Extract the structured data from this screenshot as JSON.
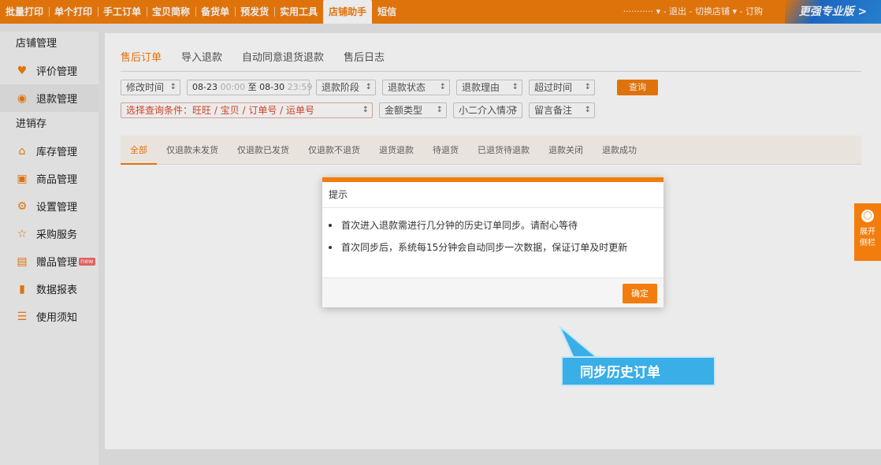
{
  "topnav": {
    "items": [
      "批量打印",
      "单个打印",
      "手工订单",
      "宝贝简称",
      "备货单",
      "预发货",
      "实用工具",
      "店铺助手",
      "短信"
    ],
    "active_index": 7,
    "right_text": "··········· ▾ - 退出 - 切换店铺 ▾ - 订购",
    "pro_button": "更强专业版 >"
  },
  "sidebar": {
    "group1": "店铺管理",
    "items1": [
      {
        "icon": "heart-icon",
        "label": "评价管理"
      },
      {
        "icon": "refund-icon",
        "label": "退款管理"
      }
    ],
    "group2": "进销存",
    "items2": [
      {
        "icon": "warehouse-icon",
        "label": "库存管理"
      },
      {
        "icon": "goods-icon",
        "label": "商品管理"
      },
      {
        "icon": "gear-icon",
        "label": "设置管理"
      },
      {
        "icon": "cart-icon",
        "label": "采购服务"
      },
      {
        "icon": "gift-icon",
        "label": "赠品管理",
        "badge": "new"
      },
      {
        "icon": "bar-chart-icon",
        "label": "数据报表"
      },
      {
        "icon": "doc-icon",
        "label": "使用须知"
      }
    ]
  },
  "tabs": [
    "售后订单",
    "导入退款",
    "自动同意退货退款",
    "售后日志"
  ],
  "filters": {
    "time_select": "修改时间",
    "date_start": "08-23",
    "date_start_time": "00:00",
    "date_sep": "至",
    "date_end": "08-30",
    "date_end_time": "23:59",
    "refund_stage": "退款阶段",
    "refund_status": "退款状态",
    "refund_reason": "退款理由",
    "overtime": "超过时间",
    "query_button": "查询",
    "condition_select": "选择查询条件：旺旺 / 宝贝 / 订单号 / 运单号",
    "amount_type": "金额类型",
    "xiaoer": "小二介入情况",
    "remark": "留言备注"
  },
  "subtabs": [
    "全部",
    "仅退款未发货",
    "仅退款已发货",
    "仅退款不退货",
    "退货退款",
    "待退货",
    "已退货待退款",
    "退款关闭",
    "退款成功"
  ],
  "modal": {
    "title": "提示",
    "lines": [
      "首次进入退款需进行几分钟的历史订单同步。请耐心等待",
      "首次同步后，系统每15分钟会自动同步一次数据，保证订单及时更新"
    ],
    "ok_button": "确定"
  },
  "callout": "同步历史订单",
  "side_expand": "展开侧栏"
}
